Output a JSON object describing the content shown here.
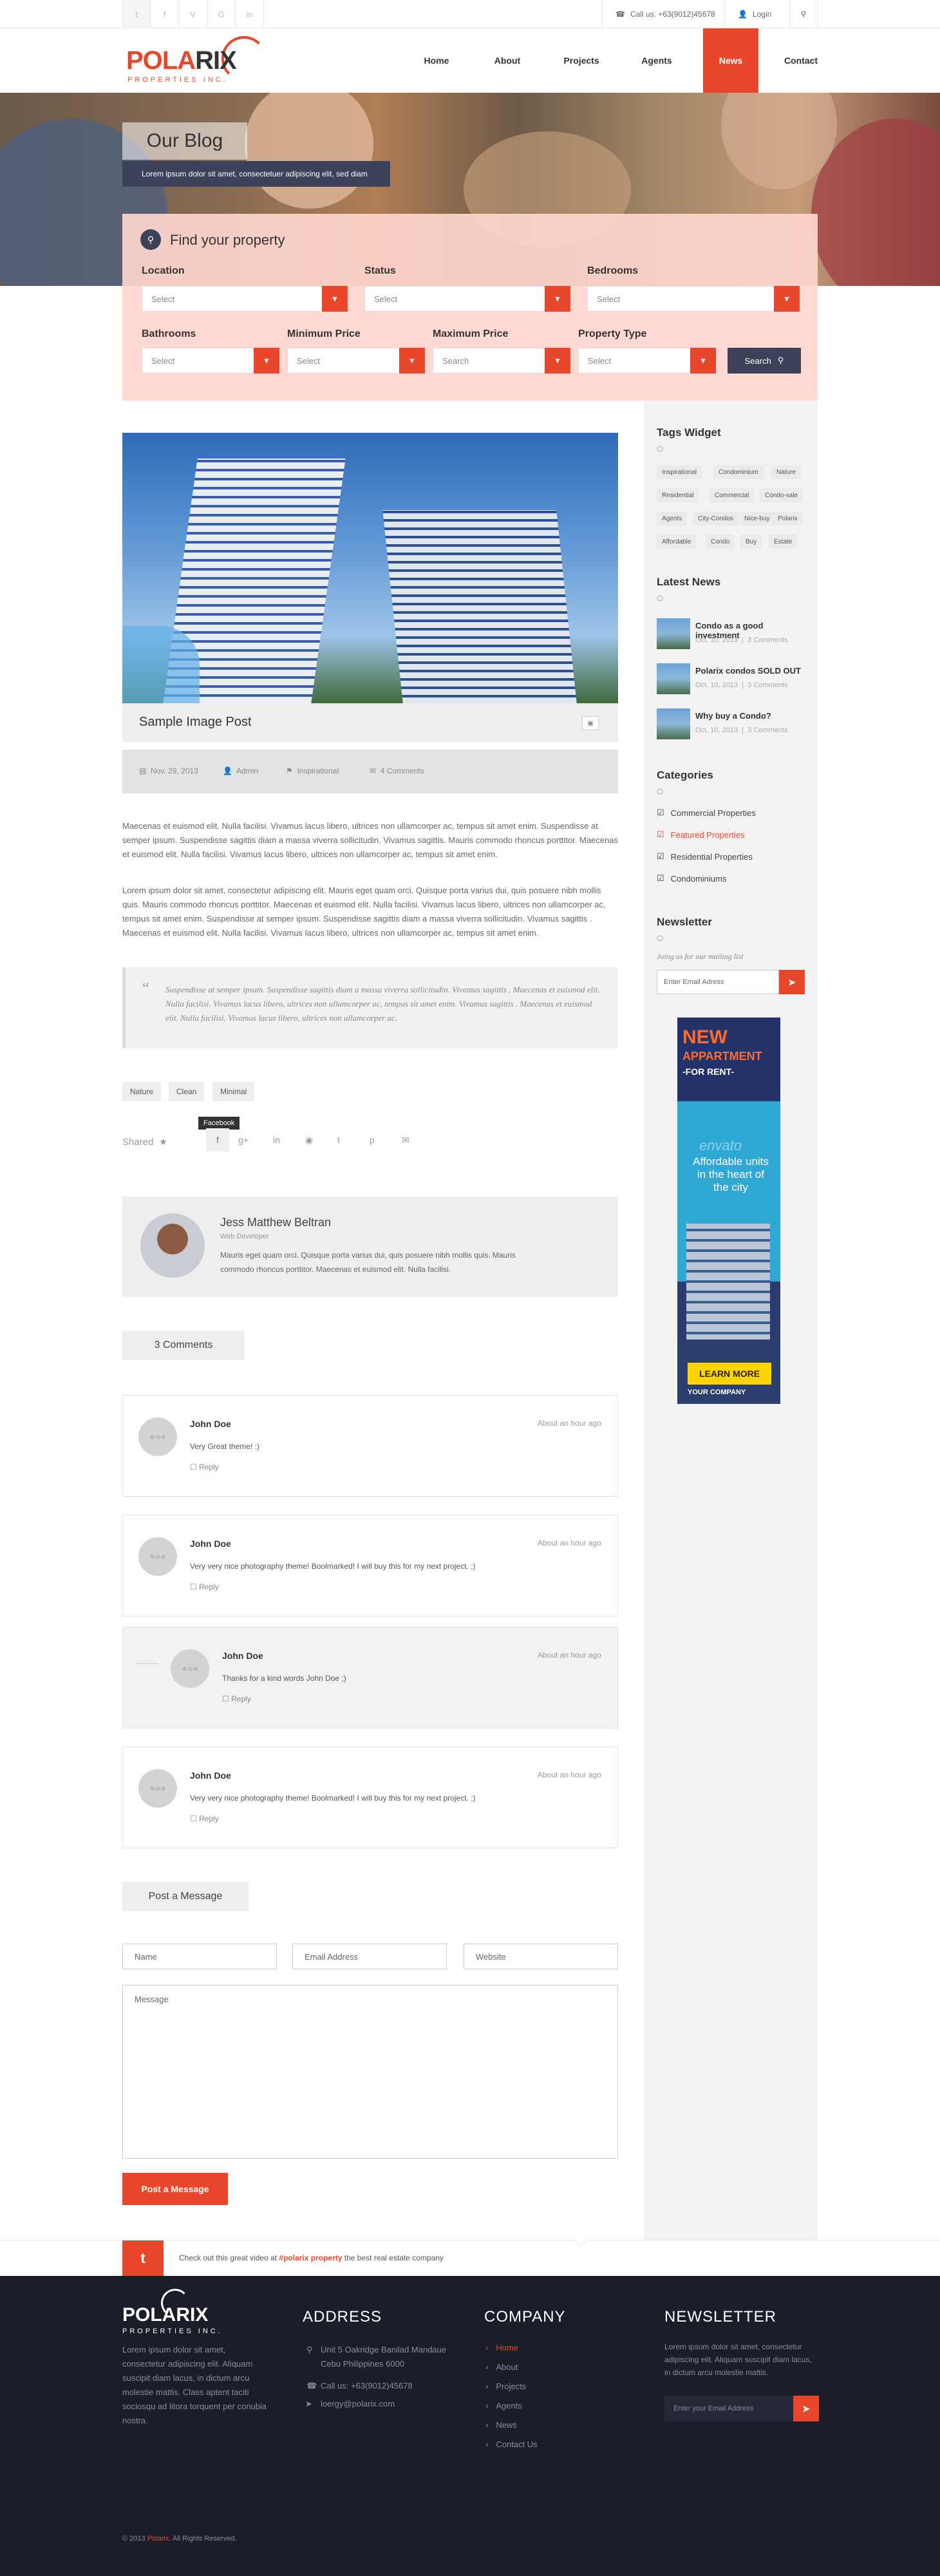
{
  "topbar": {
    "social": [
      "t",
      "f",
      "V",
      "G",
      "in"
    ],
    "phone": "Call us: +63(9012)45678",
    "login": "Login"
  },
  "brand": {
    "name_a": "POLA",
    "name_b": "RIX",
    "sub": "PROPERTIES INC."
  },
  "nav": [
    "Home",
    "About",
    "Projects",
    "Agents",
    "News",
    "Contact"
  ],
  "hero": {
    "title": "Our Blog",
    "subtitle": "Lorem ipsum dolor sit amet, consectetuer adipiscing elit, sed diam"
  },
  "search": {
    "title": "Find your property",
    "row1": [
      {
        "label": "Location",
        "value": "Select"
      },
      {
        "label": "Status",
        "value": "Select"
      },
      {
        "label": "Bedrooms",
        "value": "Select"
      }
    ],
    "row2": [
      {
        "label": "Bathrooms",
        "value": "Select"
      },
      {
        "label": "Minimum Price",
        "value": "Select"
      },
      {
        "label": "Maximum Price",
        "value": "Search"
      },
      {
        "label": "Property Type",
        "value": "Select"
      }
    ],
    "button": "Search"
  },
  "post": {
    "title": "Sample Image Post",
    "date": "Nov. 29, 2013",
    "author": "Admin",
    "category": "Inspirational",
    "comments": "4 Comments",
    "para1": "Maecenas et euismod elit. Nulla facilisi. Vivamus lacus libero, ultrices non ullamcorper ac, tempus sit amet enim. Suspendisse at semper ipsum. Suspendisse sagittis diam a massa viverra sollicitudin. Vivamus sagittis. Mauris commodo rhoncus porttitor. Maecenas et euismod elit. Nulla facilisi. Vivamus lacus libero, ultrices non ullamcorper ac, tempus sit amet enim.",
    "para2": "Lorem ipsum dolor sit amet, consectetur adipiscing elit. Mauris eget quam orci. Quisque porta varius dui, quis posuere nibh mollis quis. Mauris commodo rhoncus porttitor. Maecenas et euismod elit. Nulla facilisi. Vivamus lacus libero, ultrices non ullamcorper ac, tempus sit amet enim. Suspendisse at semper ipsum. Suspendisse sagittis diam a massa viverra sollicitudin. Vivamus sagittis . Maecenas et euismod elit. Nulla facilisi. Vivamus lacus libero, ultrices non ullamcorper ac, tempus sit amet enim.",
    "quote": "Suspendisse at semper ipsum. Suspendisse sagittis diam a massa viverra sollicitudin. Vivamus sagittis . Maecenas et euismod elit. Nulla facilisi. Vivamus lacus libero, ultrices non ullamcorper ac, tempus sit amet enim. Vivamus sagittis . Maecenas et euismod elit. Nulla facilisi. Vivamus lacus libero, ultrices non ullamcorper ac.",
    "tags": [
      "Nature",
      "Clean",
      "Minimal"
    ],
    "shared": "Shared",
    "tooltip": "Facebook"
  },
  "author": {
    "name": "Jess Matthew Beltran",
    "role": "Web Developer",
    "bio": "Mauris eget quam orci. Quisque porta varius dui, quis posuere nibh mollis quis. Mauris commodo rhoncus porttitor. Maecenas et euismod elit. Nulla facilisi."
  },
  "comments": {
    "count_label": "3 Comments",
    "items": [
      {
        "name": "John Doe",
        "time": "About an hour ago",
        "text": "Very Great theme! :)",
        "reply": "Reply",
        "avatar": "a-u-a"
      },
      {
        "name": "John Doe",
        "time": "About an hour ago",
        "text": "Very very nice photography theme! Boolmarked! I will buy this for my next project. ;)",
        "reply": "Reply",
        "avatar": "a-u-a"
      },
      {
        "name": "John Doe",
        "time": "About an hour ago",
        "text": "Thanks for a kind words John Doe ;)",
        "reply": "Reply",
        "avatar": "a-u-a"
      },
      {
        "name": "John Doe",
        "time": "About an hour ago",
        "text": "Very very nice photography theme! Boolmarked! I will buy this for my next project. ;)",
        "reply": "Reply",
        "avatar": "a-u-a"
      }
    ]
  },
  "form": {
    "title": "Post a Message",
    "name": "Name",
    "email": "Email Address",
    "website": "Website",
    "message": "Message",
    "button": "Post a Message"
  },
  "sidebar": {
    "tags_title": "Tags Widget",
    "tags": [
      "Inspirational",
      "Condominium",
      "Nature",
      "Residential",
      "Commercial",
      "Condo-sale",
      "Agents",
      "City-Condos",
      "Nice-buy",
      "Polarix",
      "Affordable",
      "Condo",
      "Buy",
      "Estate"
    ],
    "news_title": "Latest News",
    "news": [
      {
        "title": "Condo as a good investment",
        "date": "Oct. 10, 2013",
        "comments": "3 Comments"
      },
      {
        "title": "Polarix condos SOLD OUT",
        "date": "Oct. 10, 2013",
        "comments": "3 Comments"
      },
      {
        "title": "Why buy a Condo?",
        "date": "Oct. 10, 2013",
        "comments": "3 Comments"
      }
    ],
    "cat_title": "Categories",
    "categories": [
      "Commercial Properties",
      "Featured Properties",
      "Residential Properties",
      "Condominiums"
    ],
    "newsletter_title": "Newsletter",
    "newsletter_sub": "Joing us for our mailing list",
    "newsletter_placeholder": "Enter Email Adress",
    "ad": {
      "line1": "NEW",
      "line2": "APPARTMENT",
      "line3": "-FOR RENT-",
      "brand": "envato",
      "body": "Affordable units in the heart of the city",
      "cta": "LEARN MORE",
      "company": "YOUR COMPANY"
    }
  },
  "tweet": {
    "before": "Check out this great video at ",
    "link": "#polarix property",
    "after": " the best real estate company"
  },
  "footer": {
    "about": "Lorem ipsum dolor sit amet, consectetur adipiscing elit. Aliquam suscipit diam lacus, in dictum arcu molestie mattis. Class aptent taciti sociosqu ad litora torquent per conubia nostra.",
    "address_title": "ADDRESS",
    "address": "Unit 5 Oakridge Banilad Mandaue Cebu Philippines 6000",
    "phone": "Call us: +63(9012)45678",
    "email": "loergy@polarix.com",
    "company_title": "COMPANY",
    "company_links": [
      "Home",
      "About",
      "Projects",
      "Agents",
      "News",
      "Contact Us"
    ],
    "newsletter_title": "NEWSLETTER",
    "newsletter_text": "Lorem ipsum dolor sit amet, consectetur adipiscing elit. Aliquam suscipit diam lacus, in dictum arcu molestie mattis.",
    "newsletter_placeholder": "Enter your Email Address",
    "copyright_a": "© 2013 ",
    "copyright_b": "Polarix",
    "copyright_c": ". All Rights Reserved."
  },
  "colors": {
    "accent": "#e8472b",
    "footer_bg": "#1b1e29",
    "panel": "#ffd6ce"
  }
}
